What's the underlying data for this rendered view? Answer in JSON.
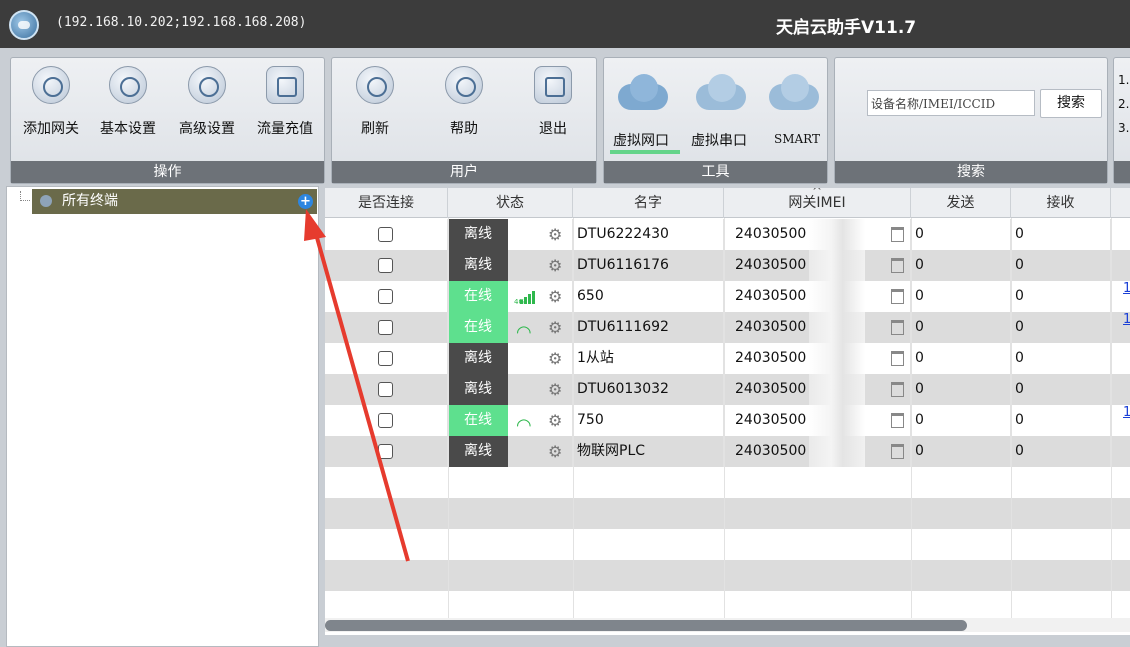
{
  "window": {
    "ip_text": "(192.168.10.202;192.168.168.208)",
    "title": "天启云助手V11.7"
  },
  "toolbar": {
    "ops": {
      "footer": "操作",
      "add_gateway": "添加网关",
      "basic_settings": "基本设置",
      "advanced_settings": "高级设置",
      "data_recharge": "流量充值"
    },
    "user": {
      "footer": "用户",
      "refresh": "刷新",
      "help": "帮助",
      "exit": "退出"
    },
    "tools": {
      "footer": "工具",
      "virtual_net_port": "虚拟网口",
      "virtual_serial_port": "虚拟串口",
      "smart": "SMART"
    },
    "search": {
      "footer": "搜索",
      "placeholder": "设备名称/IMEI/ICCID",
      "button": "搜索"
    },
    "hints": [
      "1.",
      "2.",
      "3."
    ]
  },
  "tree": {
    "root_label": "所有终端",
    "add_icon": "+"
  },
  "grid": {
    "headers": {
      "connect": "是否连接",
      "status": "状态",
      "name": "名字",
      "imei": "网关IMEI",
      "send": "发送",
      "receive": "接收"
    },
    "rows": [
      {
        "status": "离线",
        "online": false,
        "signal": "",
        "name": "DTU6222430",
        "imei": "24030500",
        "send": "0",
        "recv": "0",
        "link": ""
      },
      {
        "status": "离线",
        "online": false,
        "signal": "",
        "name": "DTU6116176",
        "imei": "24030500",
        "send": "0",
        "recv": "0",
        "link": ""
      },
      {
        "status": "在线",
        "online": true,
        "signal": "4g",
        "name": "650",
        "imei": "24030500",
        "send": "0",
        "recv": "0",
        "link": "1"
      },
      {
        "status": "在线",
        "online": true,
        "signal": "wifi",
        "name": "DTU6111692",
        "imei": "24030500",
        "send": "0",
        "recv": "0",
        "link": "1"
      },
      {
        "status": "离线",
        "online": false,
        "signal": "",
        "name": "1从站",
        "imei": "24030500",
        "send": "0",
        "recv": "0",
        "link": ""
      },
      {
        "status": "离线",
        "online": false,
        "signal": "",
        "name": "DTU6013032",
        "imei": "24030500",
        "send": "0",
        "recv": "0",
        "link": ""
      },
      {
        "status": "在线",
        "online": true,
        "signal": "wifi",
        "name": "750",
        "imei": "24030500",
        "send": "0",
        "recv": "0",
        "link": "1"
      },
      {
        "status": "离线",
        "online": false,
        "signal": "",
        "name": "物联网PLC",
        "imei": "24030500",
        "send": "0",
        "recv": "0",
        "link": ""
      }
    ]
  },
  "icons": {
    "gear": "gear-icon",
    "wifi": "wifi-icon",
    "trash": "trash-icon",
    "signal_4g": "4g-signal-icon"
  },
  "colors": {
    "online": "#5ee08e",
    "offline": "#4a4a4a",
    "footer": "#6d7278",
    "annotation_arrow": "#e63b2e"
  }
}
